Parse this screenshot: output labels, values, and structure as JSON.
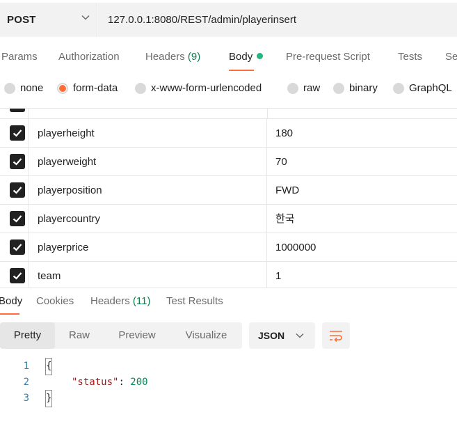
{
  "request": {
    "method": "POST",
    "url": "127.0.0.1:8080/REST/admin/playerinsert"
  },
  "request_tabs": [
    {
      "label": "Params",
      "count": ""
    },
    {
      "label": "Authorization",
      "count": ""
    },
    {
      "label": "Headers",
      "count": "(9)"
    },
    {
      "label": "Body",
      "count": ""
    },
    {
      "label": "Pre-request Script",
      "count": ""
    },
    {
      "label": "Tests",
      "count": ""
    },
    {
      "label": "Se",
      "count": ""
    }
  ],
  "active_request_tab": "Body",
  "body_types": [
    {
      "label": "none",
      "selected": false
    },
    {
      "label": "form-data",
      "selected": true
    },
    {
      "label": "x-www-form-urlencoded",
      "selected": false
    },
    {
      "label": "raw",
      "selected": false
    },
    {
      "label": "binary",
      "selected": false
    },
    {
      "label": "GraphQL",
      "selected": false
    }
  ],
  "form_rows": [
    {
      "key": "playerheight",
      "value": "180",
      "checked": true
    },
    {
      "key": "playerweight",
      "value": "70",
      "checked": true
    },
    {
      "key": "playerposition",
      "value": "FWD",
      "checked": true
    },
    {
      "key": "playercountry",
      "value": "한국",
      "checked": true
    },
    {
      "key": "playerprice",
      "value": "1000000",
      "checked": true
    },
    {
      "key": "team",
      "value": "1",
      "checked": true
    }
  ],
  "response_tabs": [
    {
      "label": "Body",
      "count": ""
    },
    {
      "label": "Cookies",
      "count": ""
    },
    {
      "label": "Headers",
      "count": "(11)"
    },
    {
      "label": "Test Results",
      "count": ""
    }
  ],
  "active_response_tab": "Body",
  "view_modes": [
    "Pretty",
    "Raw",
    "Preview",
    "Visualize"
  ],
  "active_view_mode": "Pretty",
  "format": "JSON",
  "response_body": {
    "lines": [
      {
        "num": "1",
        "text": "{"
      },
      {
        "num": "2",
        "key": "\"status\"",
        "sep": ": ",
        "value": "200"
      },
      {
        "num": "3",
        "text": "}"
      }
    ]
  },
  "colors": {
    "accent": "#ff6c37",
    "dot": "#26b47f",
    "count": "#0c7d4d"
  }
}
